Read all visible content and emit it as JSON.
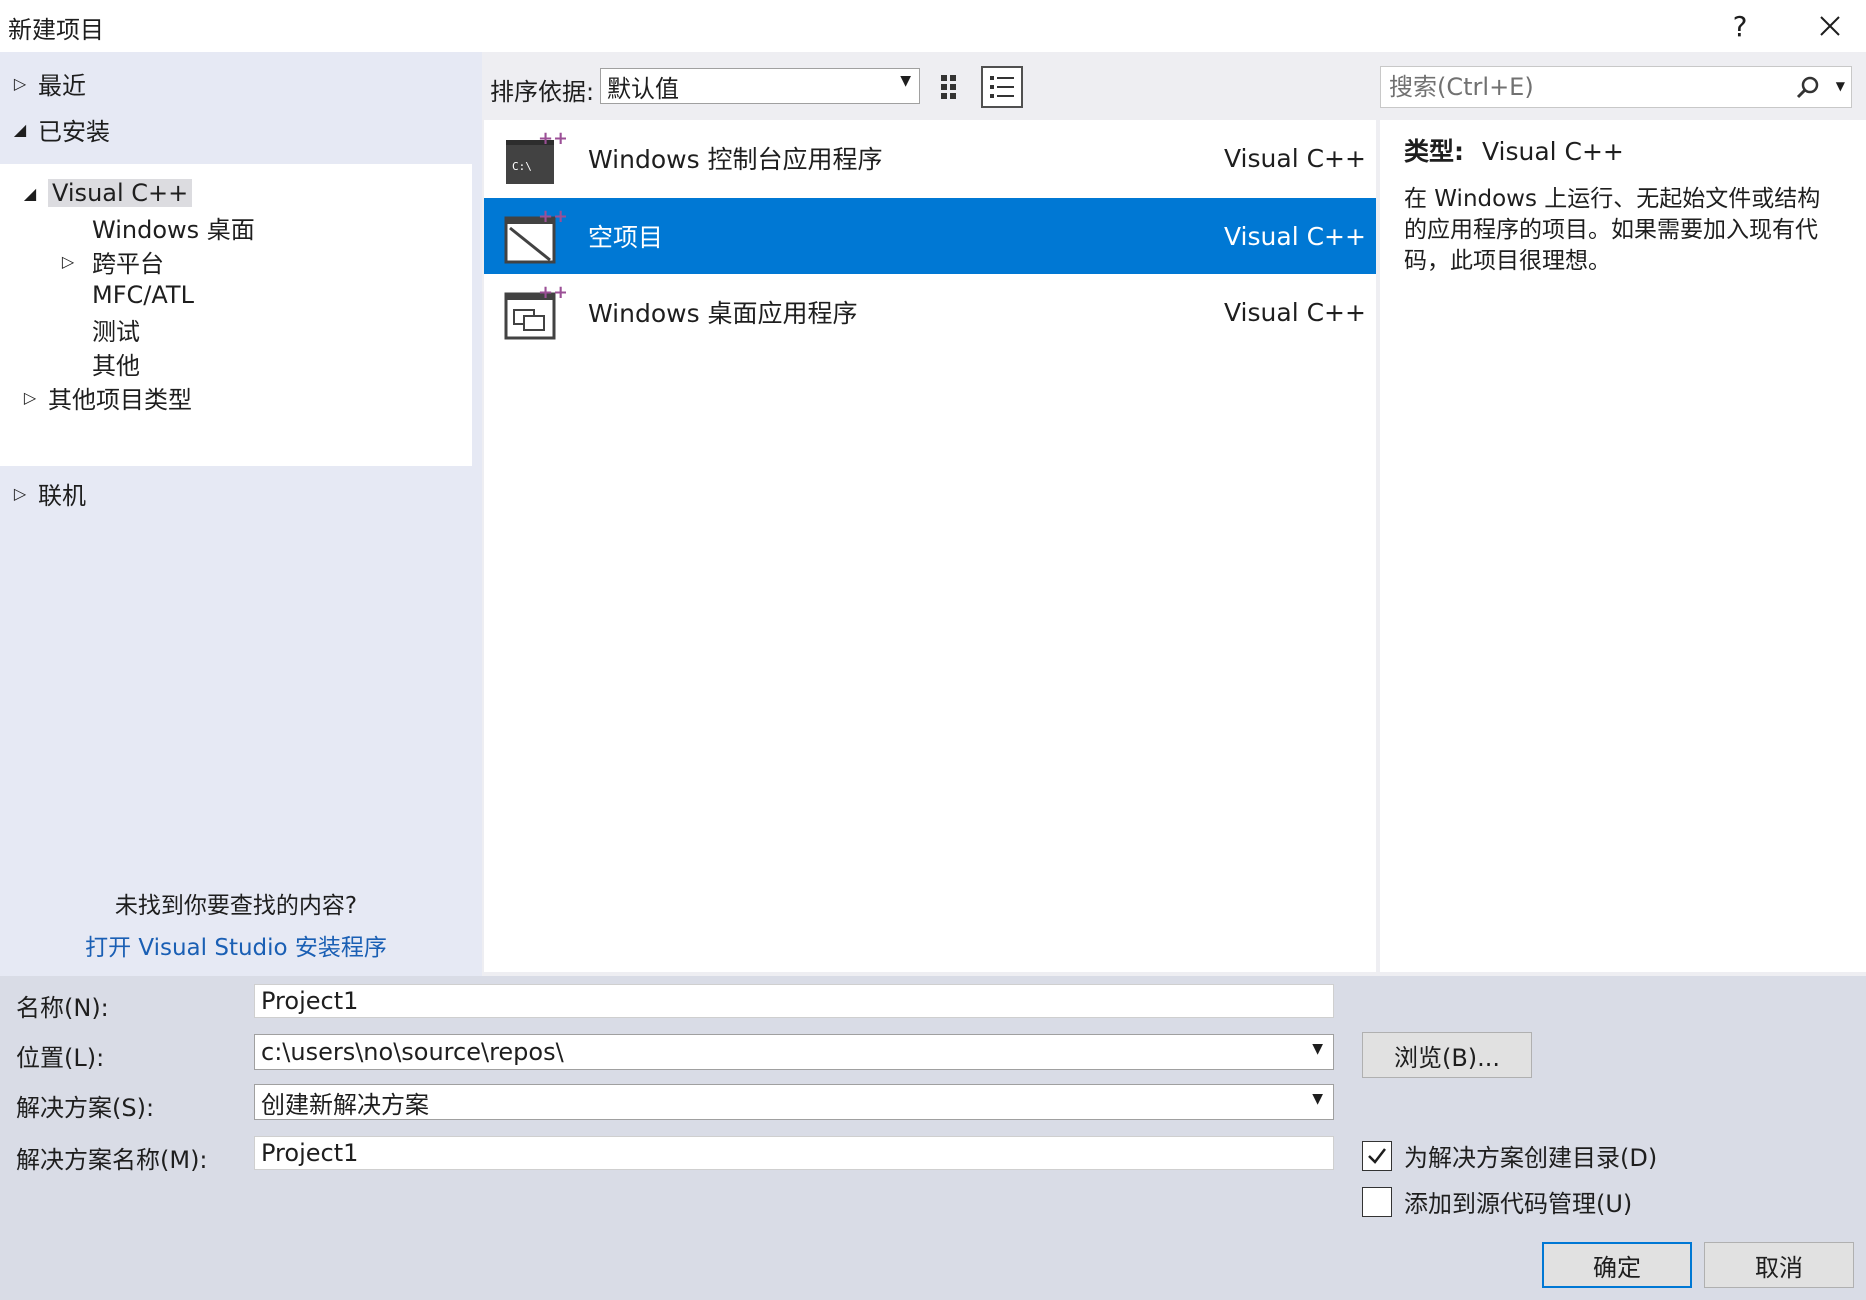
{
  "window": {
    "title": "新建项目",
    "help_label": "?",
    "close_label": "✕"
  },
  "tree": {
    "recent": "最近",
    "installed": "已安装",
    "visual_cpp": "Visual C++",
    "windows_desktop": "Windows 桌面",
    "cross_platform": "跨平台",
    "mfc_atl": "MFC/ATL",
    "test": "测试",
    "other": "其他",
    "other_project_types": "其他项目类型",
    "online": "联机"
  },
  "left_hint": {
    "question": "未找到你要查找的内容?",
    "link": "打开 Visual Studio 安装程序"
  },
  "toolbar": {
    "sort_label": "排序依据:",
    "sort_value": "默认值"
  },
  "search": {
    "placeholder": "搜索(Ctrl+E)"
  },
  "templates": [
    {
      "name": "Windows 控制台应用程序",
      "lang": "Visual C++",
      "icon": "console-app-icon"
    },
    {
      "name": "空项目",
      "lang": "Visual C++",
      "icon": "empty-project-icon",
      "selected": true
    },
    {
      "name": "Windows 桌面应用程序",
      "lang": "Visual C++",
      "icon": "desktop-app-icon"
    }
  ],
  "description": {
    "type_label": "类型:",
    "type_value": "Visual C++",
    "text": "在 Windows 上运行、无起始文件或结构的应用程序的项目。如果需要加入现有代码，此项目很理想。"
  },
  "form": {
    "name_label": "名称(N):",
    "name_value": "Project1",
    "location_label": "位置(L):",
    "location_value": "c:\\users\\no\\source\\repos\\",
    "solution_label": "解决方案(S):",
    "solution_value": "创建新解决方案",
    "solution_name_label": "解决方案名称(M):",
    "solution_name_value": "Project1",
    "browse_label": "浏览(B)...",
    "create_dir_label": "为解决方案创建目录(D)",
    "create_dir_checked": true,
    "source_control_label": "添加到源代码管理(U)",
    "source_control_checked": false,
    "ok_label": "确定",
    "cancel_label": "取消"
  },
  "colors": {
    "accent": "#0078d4",
    "plus_accent": "#9b4f96"
  }
}
